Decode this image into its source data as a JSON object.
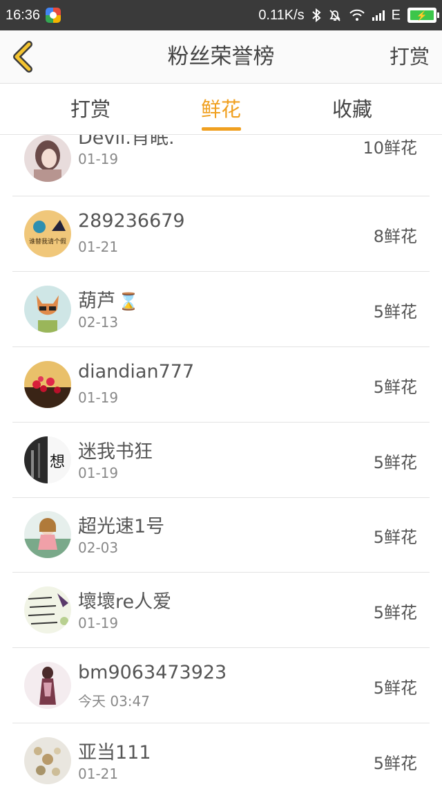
{
  "status_bar": {
    "time": "16:36",
    "net_speed": "0.11K/s",
    "network_type": "E",
    "icons": [
      "app-icon",
      "bluetooth-icon",
      "mute-bell-icon",
      "wifi-icon",
      "signal-icon",
      "battery-charging-icon"
    ]
  },
  "nav": {
    "title": "粉丝荣誉榜",
    "action_label": "打赏",
    "back_icon": "chevron-left-icon",
    "accent_color": "#f0a020"
  },
  "tabs": [
    {
      "label": "打赏",
      "active": false
    },
    {
      "label": "鲜花",
      "active": true
    },
    {
      "label": "收藏",
      "active": false
    }
  ],
  "fans": [
    {
      "name": "Devil.肖眠.",
      "date": "01-19",
      "count": "10鲜花"
    },
    {
      "name": "289236679",
      "date": "01-21",
      "count": "8鲜花"
    },
    {
      "name": "葫芦",
      "date": "02-13",
      "count": "5鲜花",
      "badge_icon": "hourglass-icon"
    },
    {
      "name": "diandian777",
      "date": "01-19",
      "count": "5鲜花"
    },
    {
      "name": "迷我书狂",
      "date": "01-19",
      "count": "5鲜花",
      "avatar_text": "想"
    },
    {
      "name": "超光速1号",
      "date": "02-03",
      "count": "5鲜花"
    },
    {
      "name": "壞壞re人爱",
      "date": "01-19",
      "count": "5鲜花"
    },
    {
      "name": "bm9063473923",
      "date": "今天 03:47",
      "count": "5鲜花"
    },
    {
      "name": "亚当111",
      "date": "01-21",
      "count": "5鲜花"
    }
  ],
  "avatar2_text": "谁替我请个假"
}
